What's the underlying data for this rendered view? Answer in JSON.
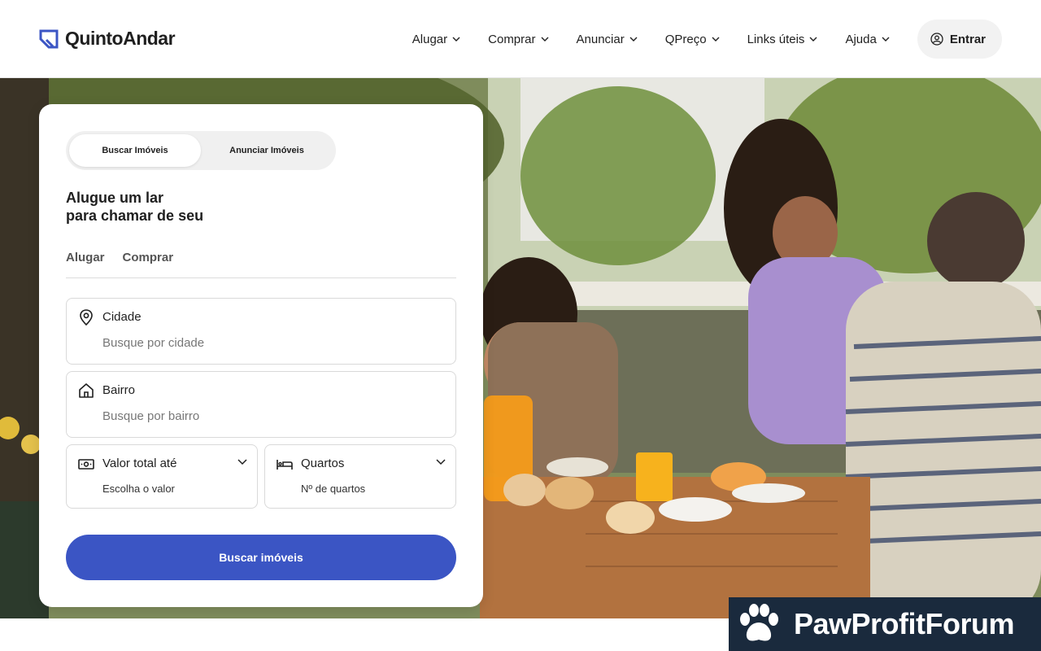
{
  "brand": {
    "name": "QuintoAndar",
    "accent": "#3b55c4"
  },
  "nav": {
    "items": [
      {
        "label": "Alugar"
      },
      {
        "label": "Comprar"
      },
      {
        "label": "Anunciar"
      },
      {
        "label": "QPreço"
      },
      {
        "label": "Links úteis"
      },
      {
        "label": "Ajuda"
      }
    ],
    "login_label": "Entrar"
  },
  "search_card": {
    "segment": {
      "active": "Buscar Imóveis",
      "inactive": "Anunciar Imóveis"
    },
    "headline_line1": "Alugue um lar",
    "headline_line2": "para chamar de seu",
    "tabs": [
      "Alugar",
      "Comprar"
    ],
    "city": {
      "label": "Cidade",
      "placeholder": "Busque por cidade"
    },
    "neighborhood": {
      "label": "Bairro",
      "placeholder": "Busque por bairro"
    },
    "price": {
      "label": "Valor total até",
      "value": "Escolha o valor"
    },
    "rooms": {
      "label": "Quartos",
      "value": "Nº de quartos"
    },
    "submit_label": "Buscar imóveis"
  },
  "watermark": {
    "text": "PawProfitForum"
  }
}
